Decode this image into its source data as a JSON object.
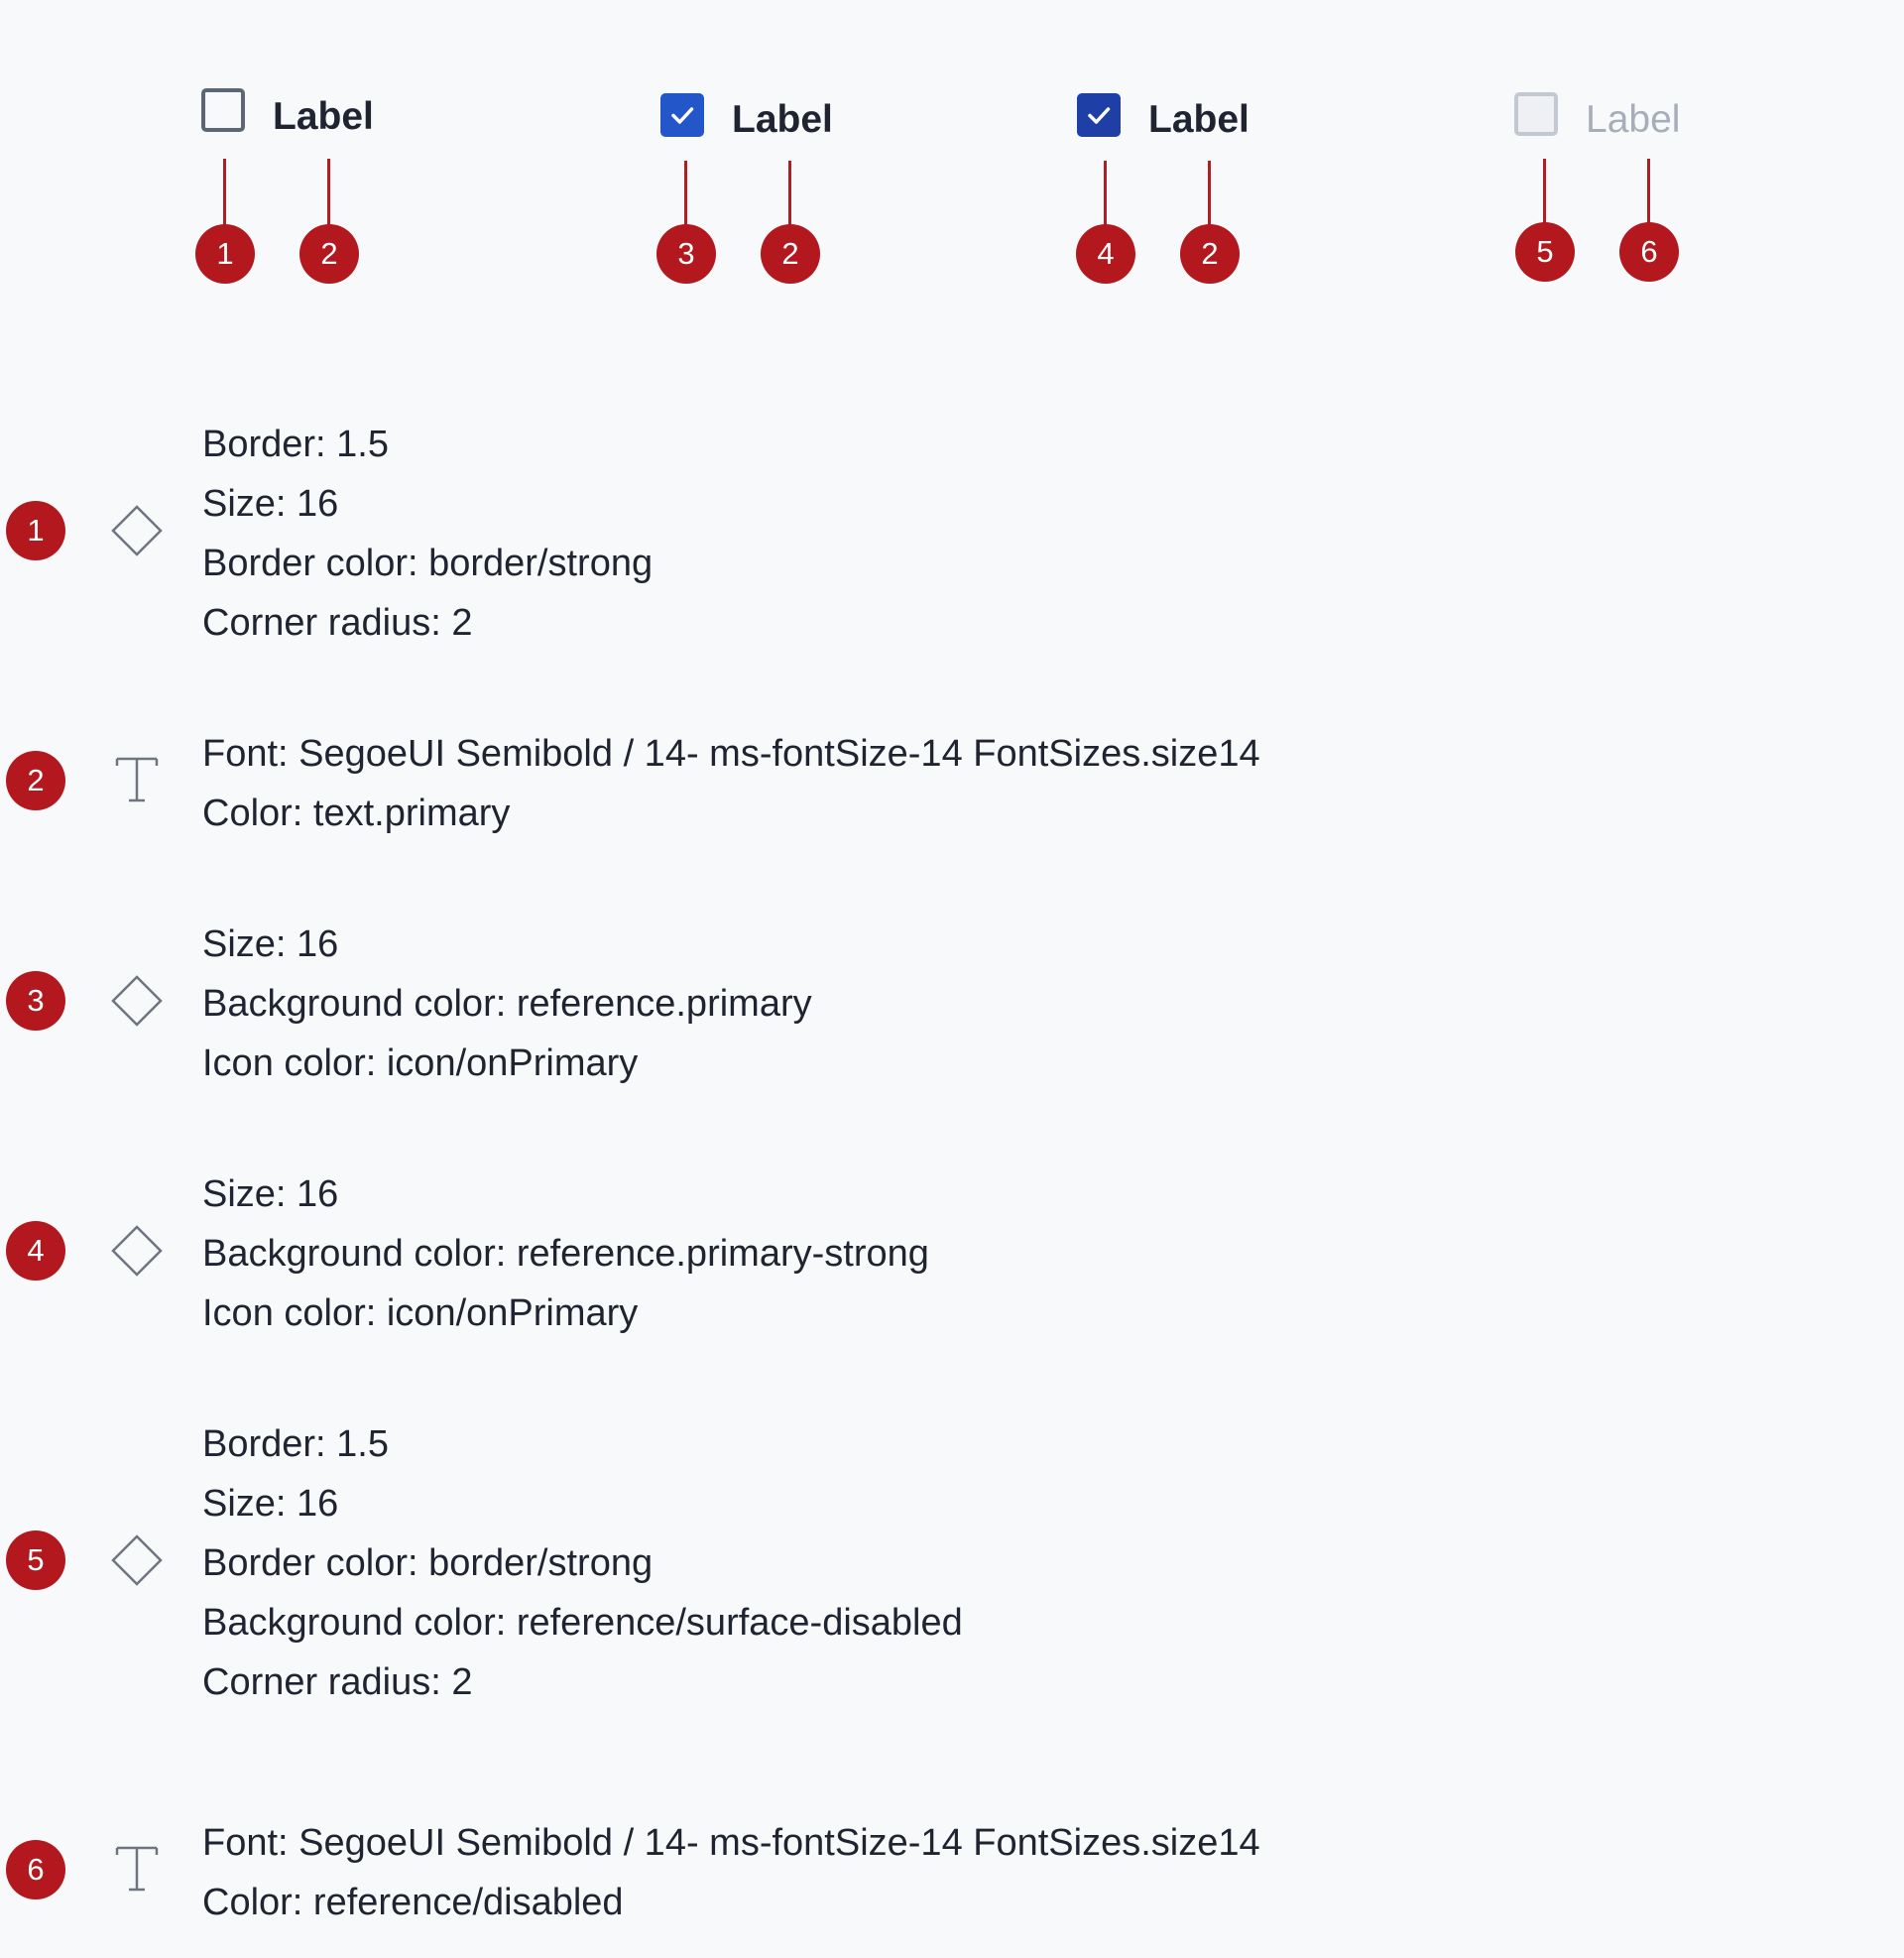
{
  "demo": {
    "items": [
      {
        "state": "unchecked",
        "label": "Label",
        "markers": [
          "1",
          "2"
        ]
      },
      {
        "state": "checked",
        "label": "Label",
        "markers": [
          "3",
          "2"
        ]
      },
      {
        "state": "checked-strong",
        "label": "Label",
        "markers": [
          "4",
          "2"
        ]
      },
      {
        "state": "disabled",
        "label": "Label",
        "markers": [
          "5",
          "6"
        ]
      }
    ]
  },
  "specs": [
    {
      "number": "1",
      "icon": "diamond-icon",
      "lines": [
        "Border: 1.5",
        "Size: 16",
        "Border color: border/strong",
        "Corner radius: 2"
      ]
    },
    {
      "number": "2",
      "icon": "text-icon",
      "lines": [
        "Font: SegoeUI Semibold / 14- ms-fontSize-14 FontSizes.size14",
        "Color: text.primary"
      ]
    },
    {
      "number": "3",
      "icon": "diamond-icon",
      "lines": [
        "Size: 16",
        "Background color: reference.primary",
        "Icon color: icon/onPrimary"
      ]
    },
    {
      "number": "4",
      "icon": "diamond-icon",
      "lines": [
        "Size: 16",
        "Background color: reference.primary-strong",
        "Icon color: icon/onPrimary"
      ]
    },
    {
      "number": "5",
      "icon": "diamond-icon",
      "lines": [
        "Border: 1.5",
        "Size: 16",
        "Border color: border/strong",
        "Background color: reference/surface-disabled",
        "Corner radius: 2"
      ]
    },
    {
      "number": "6",
      "icon": "text-icon",
      "lines": [
        "Font: SegoeUI Semibold / 14- ms-fontSize-14 FontSizes.size14",
        "Color: reference/disabled"
      ]
    }
  ],
  "colors": {
    "badge": "#b2181d",
    "primary": "#2356c9",
    "primary_strong": "#1d3fa6",
    "border_strong": "#5c6675",
    "disabled_text": "#a7aeb9"
  }
}
